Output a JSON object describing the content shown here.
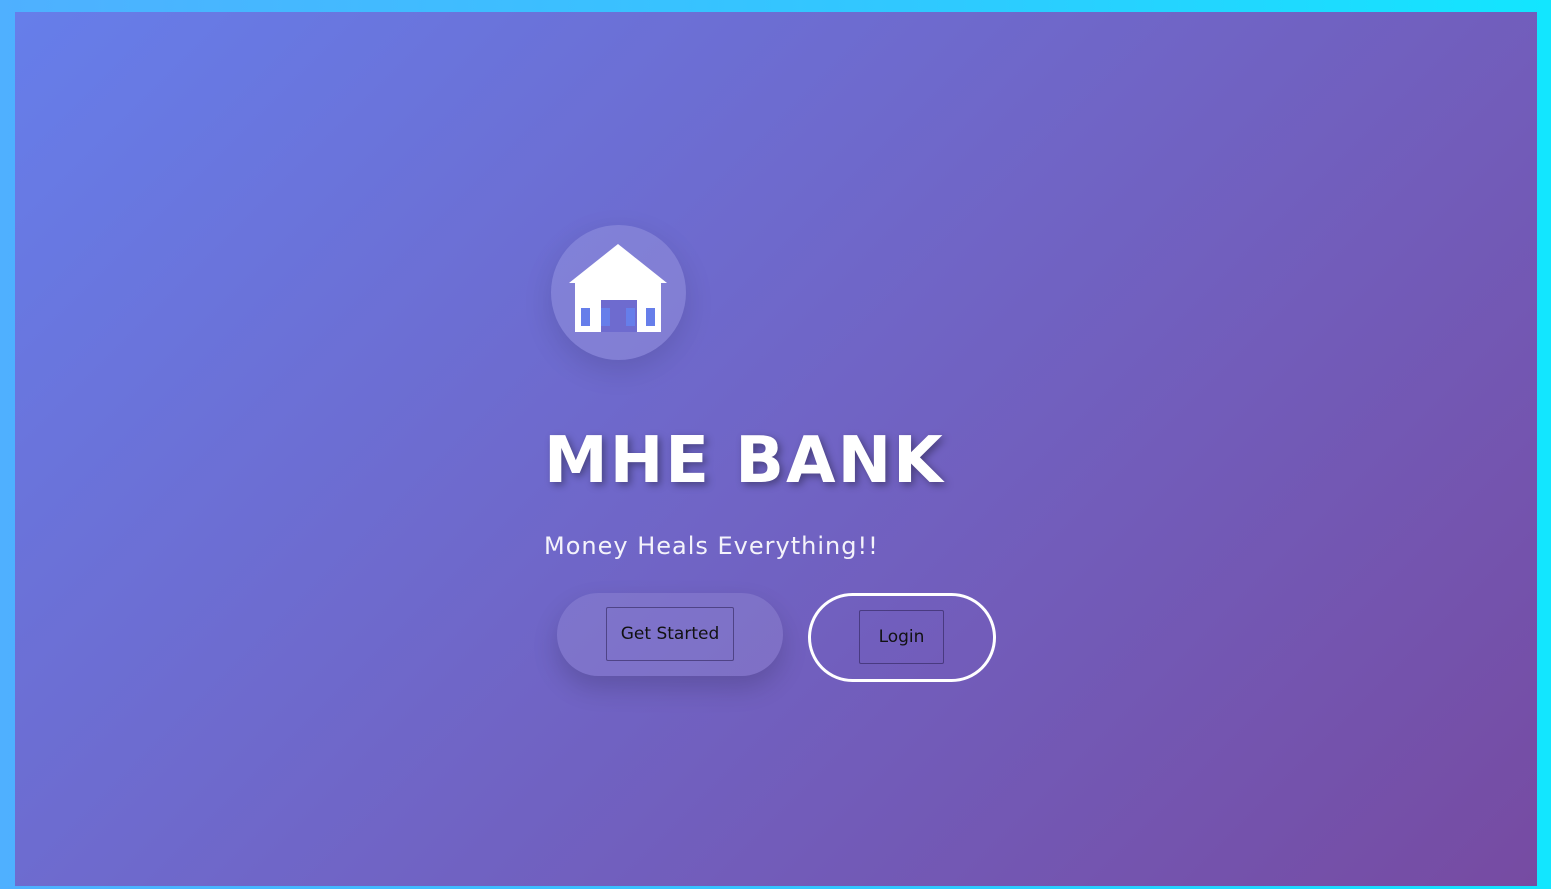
{
  "hero": {
    "title": "MHE BANK",
    "tagline": "Money Heals Everything!!",
    "logo_icon": "house-icon"
  },
  "actions": {
    "get_started_label": "Get Started",
    "login_label": "Login"
  },
  "colors": {
    "gradient_start": "#667eea",
    "gradient_end": "#764ba2",
    "frame_left": "#4fb0ff",
    "frame_right": "#12e6ff",
    "text": "#ffffff"
  }
}
